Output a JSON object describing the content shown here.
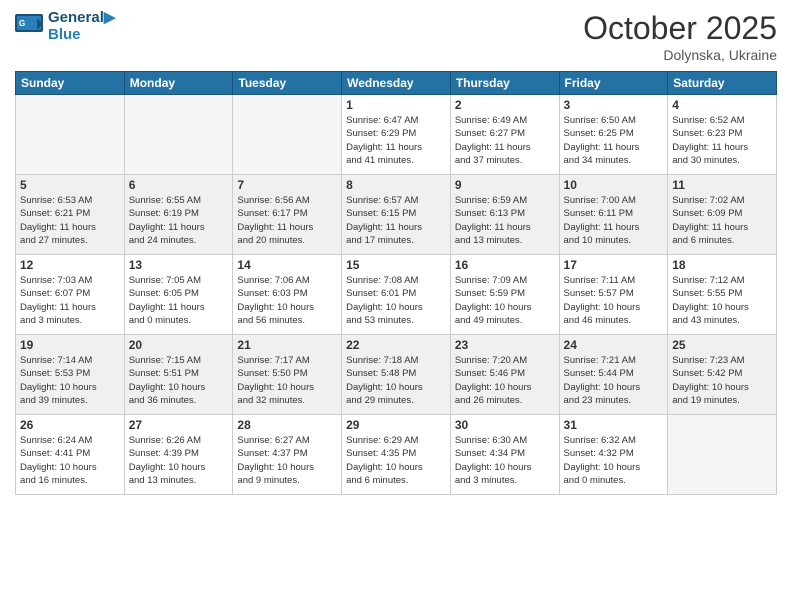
{
  "header": {
    "logo_line1": "General",
    "logo_line2": "Blue",
    "month": "October 2025",
    "location": "Dolynska, Ukraine"
  },
  "days_of_week": [
    "Sunday",
    "Monday",
    "Tuesday",
    "Wednesday",
    "Thursday",
    "Friday",
    "Saturday"
  ],
  "weeks": [
    [
      {
        "day": "",
        "info": ""
      },
      {
        "day": "",
        "info": ""
      },
      {
        "day": "",
        "info": ""
      },
      {
        "day": "1",
        "info": "Sunrise: 6:47 AM\nSunset: 6:29 PM\nDaylight: 11 hours\nand 41 minutes."
      },
      {
        "day": "2",
        "info": "Sunrise: 6:49 AM\nSunset: 6:27 PM\nDaylight: 11 hours\nand 37 minutes."
      },
      {
        "day": "3",
        "info": "Sunrise: 6:50 AM\nSunset: 6:25 PM\nDaylight: 11 hours\nand 34 minutes."
      },
      {
        "day": "4",
        "info": "Sunrise: 6:52 AM\nSunset: 6:23 PM\nDaylight: 11 hours\nand 30 minutes."
      }
    ],
    [
      {
        "day": "5",
        "info": "Sunrise: 6:53 AM\nSunset: 6:21 PM\nDaylight: 11 hours\nand 27 minutes."
      },
      {
        "day": "6",
        "info": "Sunrise: 6:55 AM\nSunset: 6:19 PM\nDaylight: 11 hours\nand 24 minutes."
      },
      {
        "day": "7",
        "info": "Sunrise: 6:56 AM\nSunset: 6:17 PM\nDaylight: 11 hours\nand 20 minutes."
      },
      {
        "day": "8",
        "info": "Sunrise: 6:57 AM\nSunset: 6:15 PM\nDaylight: 11 hours\nand 17 minutes."
      },
      {
        "day": "9",
        "info": "Sunrise: 6:59 AM\nSunset: 6:13 PM\nDaylight: 11 hours\nand 13 minutes."
      },
      {
        "day": "10",
        "info": "Sunrise: 7:00 AM\nSunset: 6:11 PM\nDaylight: 11 hours\nand 10 minutes."
      },
      {
        "day": "11",
        "info": "Sunrise: 7:02 AM\nSunset: 6:09 PM\nDaylight: 11 hours\nand 6 minutes."
      }
    ],
    [
      {
        "day": "12",
        "info": "Sunrise: 7:03 AM\nSunset: 6:07 PM\nDaylight: 11 hours\nand 3 minutes."
      },
      {
        "day": "13",
        "info": "Sunrise: 7:05 AM\nSunset: 6:05 PM\nDaylight: 11 hours\nand 0 minutes."
      },
      {
        "day": "14",
        "info": "Sunrise: 7:06 AM\nSunset: 6:03 PM\nDaylight: 10 hours\nand 56 minutes."
      },
      {
        "day": "15",
        "info": "Sunrise: 7:08 AM\nSunset: 6:01 PM\nDaylight: 10 hours\nand 53 minutes."
      },
      {
        "day": "16",
        "info": "Sunrise: 7:09 AM\nSunset: 5:59 PM\nDaylight: 10 hours\nand 49 minutes."
      },
      {
        "day": "17",
        "info": "Sunrise: 7:11 AM\nSunset: 5:57 PM\nDaylight: 10 hours\nand 46 minutes."
      },
      {
        "day": "18",
        "info": "Sunrise: 7:12 AM\nSunset: 5:55 PM\nDaylight: 10 hours\nand 43 minutes."
      }
    ],
    [
      {
        "day": "19",
        "info": "Sunrise: 7:14 AM\nSunset: 5:53 PM\nDaylight: 10 hours\nand 39 minutes."
      },
      {
        "day": "20",
        "info": "Sunrise: 7:15 AM\nSunset: 5:51 PM\nDaylight: 10 hours\nand 36 minutes."
      },
      {
        "day": "21",
        "info": "Sunrise: 7:17 AM\nSunset: 5:50 PM\nDaylight: 10 hours\nand 32 minutes."
      },
      {
        "day": "22",
        "info": "Sunrise: 7:18 AM\nSunset: 5:48 PM\nDaylight: 10 hours\nand 29 minutes."
      },
      {
        "day": "23",
        "info": "Sunrise: 7:20 AM\nSunset: 5:46 PM\nDaylight: 10 hours\nand 26 minutes."
      },
      {
        "day": "24",
        "info": "Sunrise: 7:21 AM\nSunset: 5:44 PM\nDaylight: 10 hours\nand 23 minutes."
      },
      {
        "day": "25",
        "info": "Sunrise: 7:23 AM\nSunset: 5:42 PM\nDaylight: 10 hours\nand 19 minutes."
      }
    ],
    [
      {
        "day": "26",
        "info": "Sunrise: 6:24 AM\nSunset: 4:41 PM\nDaylight: 10 hours\nand 16 minutes."
      },
      {
        "day": "27",
        "info": "Sunrise: 6:26 AM\nSunset: 4:39 PM\nDaylight: 10 hours\nand 13 minutes."
      },
      {
        "day": "28",
        "info": "Sunrise: 6:27 AM\nSunset: 4:37 PM\nDaylight: 10 hours\nand 9 minutes."
      },
      {
        "day": "29",
        "info": "Sunrise: 6:29 AM\nSunset: 4:35 PM\nDaylight: 10 hours\nand 6 minutes."
      },
      {
        "day": "30",
        "info": "Sunrise: 6:30 AM\nSunset: 4:34 PM\nDaylight: 10 hours\nand 3 minutes."
      },
      {
        "day": "31",
        "info": "Sunrise: 6:32 AM\nSunset: 4:32 PM\nDaylight: 10 hours\nand 0 minutes."
      },
      {
        "day": "",
        "info": ""
      }
    ]
  ]
}
